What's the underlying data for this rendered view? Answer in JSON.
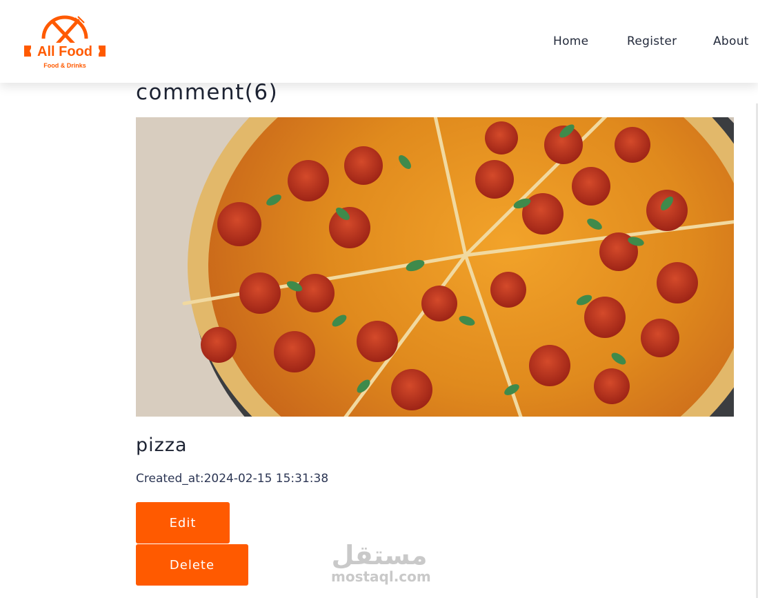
{
  "brand": {
    "name": "All Food",
    "tagline": "Food & Drinks",
    "color": "#ff5a00"
  },
  "nav": {
    "home": "Home",
    "register": "Register",
    "about": "About"
  },
  "page": {
    "heading": "comment(6)"
  },
  "post": {
    "image": "pepperoni-pizza-photo",
    "title": "pizza",
    "created_at": "Created_at:2024-02-15 15:31:38"
  },
  "actions": {
    "edit_label": "Edit",
    "delete_label": "Delete"
  },
  "watermark": {
    "arabic": "مستقل",
    "latin": "mostaql.com"
  }
}
